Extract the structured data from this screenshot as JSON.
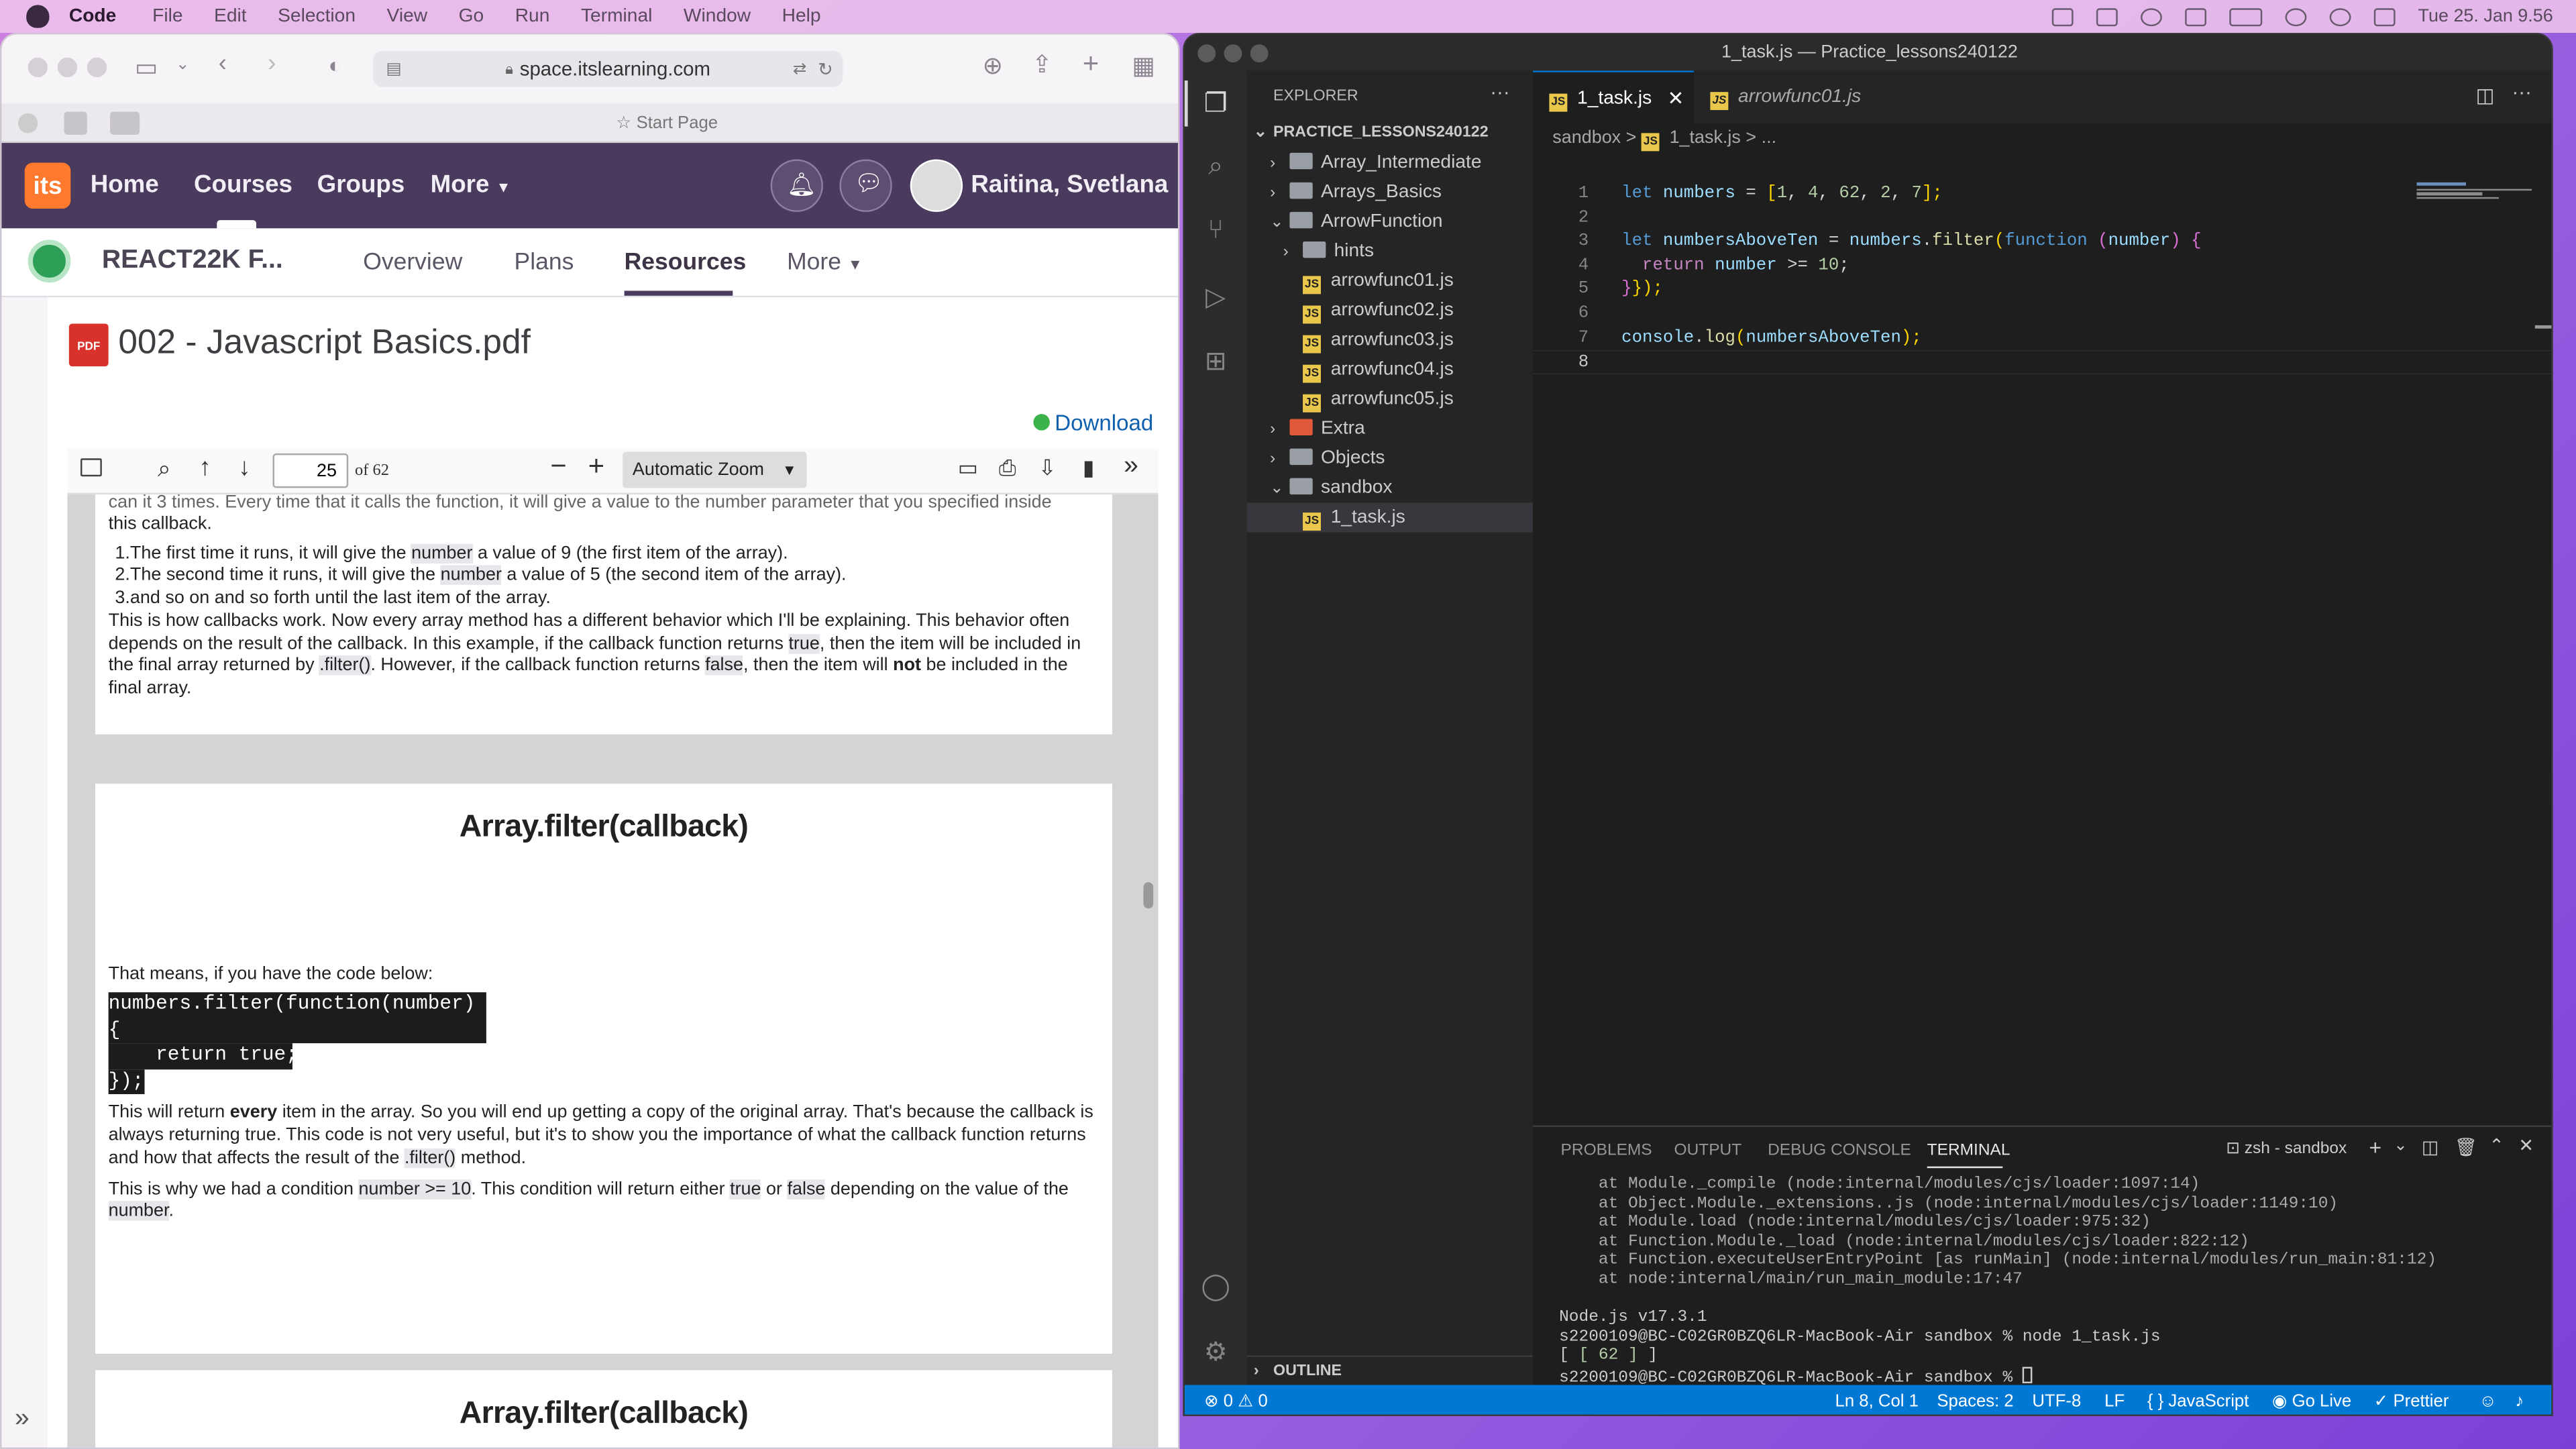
{
  "menubar": {
    "app": "Code",
    "items": [
      "File",
      "Edit",
      "Selection",
      "View",
      "Go",
      "Run",
      "Terminal",
      "Window",
      "Help"
    ],
    "clock": "Tue 25. Jan  9.56"
  },
  "safari": {
    "url": "space.itslearning.com",
    "favorites_label": "Start Page"
  },
  "itslearning": {
    "logo": "its",
    "nav": [
      "Home",
      "Courses",
      "Groups",
      "More"
    ],
    "user": "Raitina, Svetlana",
    "course_title": "REACT22K F...",
    "course_tabs": [
      "Overview",
      "Plans",
      "Resources",
      "More"
    ],
    "active_tab": "Resources"
  },
  "document": {
    "pdf_badge": "PDF",
    "title": "002 - Javascript Basics.pdf",
    "download": "Download"
  },
  "pdf_toolbar": {
    "page": "25",
    "of": "of 62",
    "zoom": "Automatic Zoom"
  },
  "pdf_page1": {
    "top_cut": "can it 3 times. Every time that it calls the function, it will give a value to the number parameter that you specified inside",
    "top_line2": "this callback.",
    "list": [
      {
        "n": "1.",
        "pre": "The first time it runs, it will give the ",
        "hl": "number",
        "post": " a value of 9 (the first item of the array)."
      },
      {
        "n": "2.",
        "pre": "The second time it runs, it will give the ",
        "hl": "number",
        "post": " a value of 5 (the second item of the array)."
      },
      {
        "n": "3.",
        "pre": "and so on and so forth until the last item of the array.",
        "hl": "",
        "post": ""
      }
    ],
    "para_a": "This is how callbacks work. Now every array method has a different behavior which I'll be explaining. This behavior often depends on the result of the callback. In this example, if the callback function returns ",
    "para_true": "true",
    "para_b": ", then the item will be included in the final array returned by ",
    "para_filter": ".filter()",
    "para_c": ". However, if the callback function returns ",
    "para_false": "false",
    "para_d": ", then the item will ",
    "para_not": "not",
    "para_e": " be included in the final array."
  },
  "pdf_page2": {
    "title": "Array.filter(callback)",
    "intro": "That means, if you have the code below:",
    "code": [
      "numbers.filter(function(number) {",
      "    return true;",
      "});"
    ],
    "p1_a": "This will return ",
    "p1_every": "every",
    "p1_b": " item in the array. So you will end up getting a copy of the original array. That's because the callback is always returning true. This code is not very useful, but it's to show you the importance of what the callback function returns and how that affects the result of the ",
    "p1_filter": ".filter()",
    "p1_c": " method.",
    "p2_a": "This is why we had a condition ",
    "p2_cond": "number >= 10",
    "p2_b": ". This condition will return either ",
    "p2_true": "true",
    "p2_c": " or ",
    "p2_false": "false",
    "p2_d": " depending on the value of the ",
    "p2_number": "number",
    "p2_e": "."
  },
  "pdf_page3": {
    "title": "Array.filter(callback)"
  },
  "vscode": {
    "window_title": "1_task.js — Practice_lessons240122",
    "explorer_title": "EXPLORER",
    "root": "PRACTICE_LESSONS240122",
    "tree": [
      "Array_Intermediate",
      "Arrays_Basics",
      "ArrowFunction",
      "hints",
      "arrowfunc01.js",
      "arrowfunc02.js",
      "arrowfunc03.js",
      "arrowfunc04.js",
      "arrowfunc05.js",
      "Extra",
      "Objects",
      "sandbox",
      "1_task.js"
    ],
    "outline": "OUTLINE",
    "tabs": [
      "1_task.js",
      "arrowfunc01.js"
    ],
    "breadcrumb": [
      "sandbox",
      ">",
      "1_task.js",
      ">",
      "..."
    ],
    "line_numbers": [
      "1",
      "2",
      "3",
      "4",
      "5",
      "6",
      "7",
      "8"
    ],
    "code": {
      "l1": [
        "let",
        " numbers",
        " =",
        " [",
        "1",
        ", ",
        "4",
        ", ",
        "62",
        ", ",
        "2",
        ", ",
        "7",
        "];"
      ],
      "l3": [
        "let",
        " numbersAboveTen",
        " = ",
        "numbers",
        ".",
        "filter",
        "(",
        "function",
        " (",
        "number",
        ") ",
        "{"
      ],
      "l4": [
        "  return",
        " number",
        " >= ",
        "10",
        ";"
      ],
      "l5": [
        "}",
        "});"
      ],
      "l7": [
        "console",
        ".",
        "log",
        "(",
        "numbersAboveTen",
        ");"
      ]
    },
    "panel_tabs": [
      "PROBLEMS",
      "OUTPUT",
      "DEBUG CONSOLE",
      "TERMINAL"
    ],
    "terminal_name": "zsh - sandbox",
    "terminal_lines": [
      "    at Module._compile (node:internal/modules/cjs/loader:1097:14)",
      "    at Object.Module._extensions..js (node:internal/modules/cjs/loader:1149:10)",
      "    at Module.load (node:internal/modules/cjs/loader:975:32)",
      "    at Function.Module._load (node:internal/modules/cjs/loader:822:12)",
      "    at Function.executeUserEntryPoint [as runMain] (node:internal/modules/run_main:81:12)",
      "    at node:internal/main/run_main_module:17:47",
      "",
      "Node.js v17.3.1",
      "s2200109@BC-C02GR0BZQ6LR-MacBook-Air sandbox % node 1_task.js",
      "[ 62 ]",
      "s2200109@BC-C02GR0BZQ6LR-MacBook-Air sandbox % "
    ],
    "status": {
      "errors": "⊗ 0 ⚠ 0",
      "position": "Ln 8, Col 1",
      "spaces": "Spaces: 2",
      "encoding": "UTF-8",
      "eol": "LF",
      "language": "JavaScript",
      "golive": "Go Live",
      "prettier": "Prettier"
    }
  }
}
